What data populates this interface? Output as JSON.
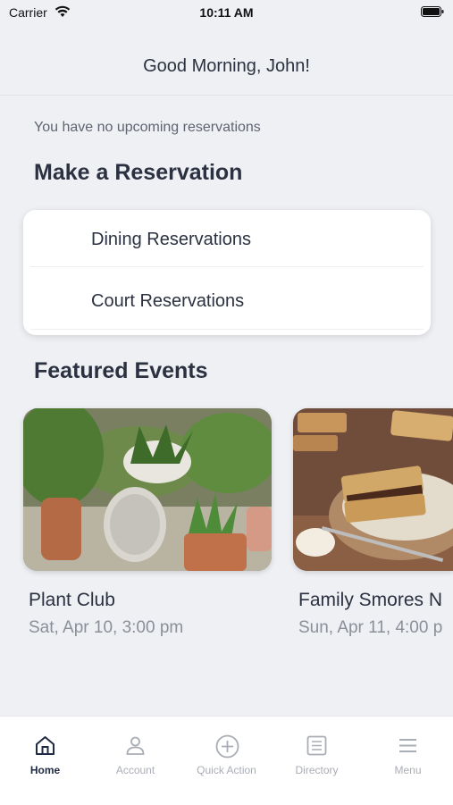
{
  "status_bar": {
    "carrier": "Carrier",
    "time": "10:11 AM"
  },
  "header": {
    "title": "Good Morning, John!"
  },
  "reservations": {
    "empty_message": "You have no upcoming reservations",
    "section_title": "Make a Reservation",
    "items": [
      {
        "label": "Dining Reservations"
      },
      {
        "label": "Court Reservations"
      }
    ]
  },
  "events": {
    "section_title": "Featured Events",
    "items": [
      {
        "title": "Plant Club",
        "date": "Sat, Apr 10, 3:00 pm",
        "image": "plants-photo"
      },
      {
        "title": "Family Smores N",
        "date": "Sun, Apr 11, 4:00 p",
        "image": "smores-photo"
      }
    ]
  },
  "tab_bar": {
    "active": "Home",
    "tabs": [
      {
        "label": "Home",
        "icon": "home-icon"
      },
      {
        "label": "Account",
        "icon": "account-icon"
      },
      {
        "label": "Quick Action",
        "icon": "plus-circle-icon"
      },
      {
        "label": "Directory",
        "icon": "directory-icon"
      },
      {
        "label": "Menu",
        "icon": "menu-icon"
      }
    ]
  },
  "colors": {
    "accent": "#1f2a44",
    "background": "#eef0f4",
    "inactive": "#a9adb5"
  }
}
